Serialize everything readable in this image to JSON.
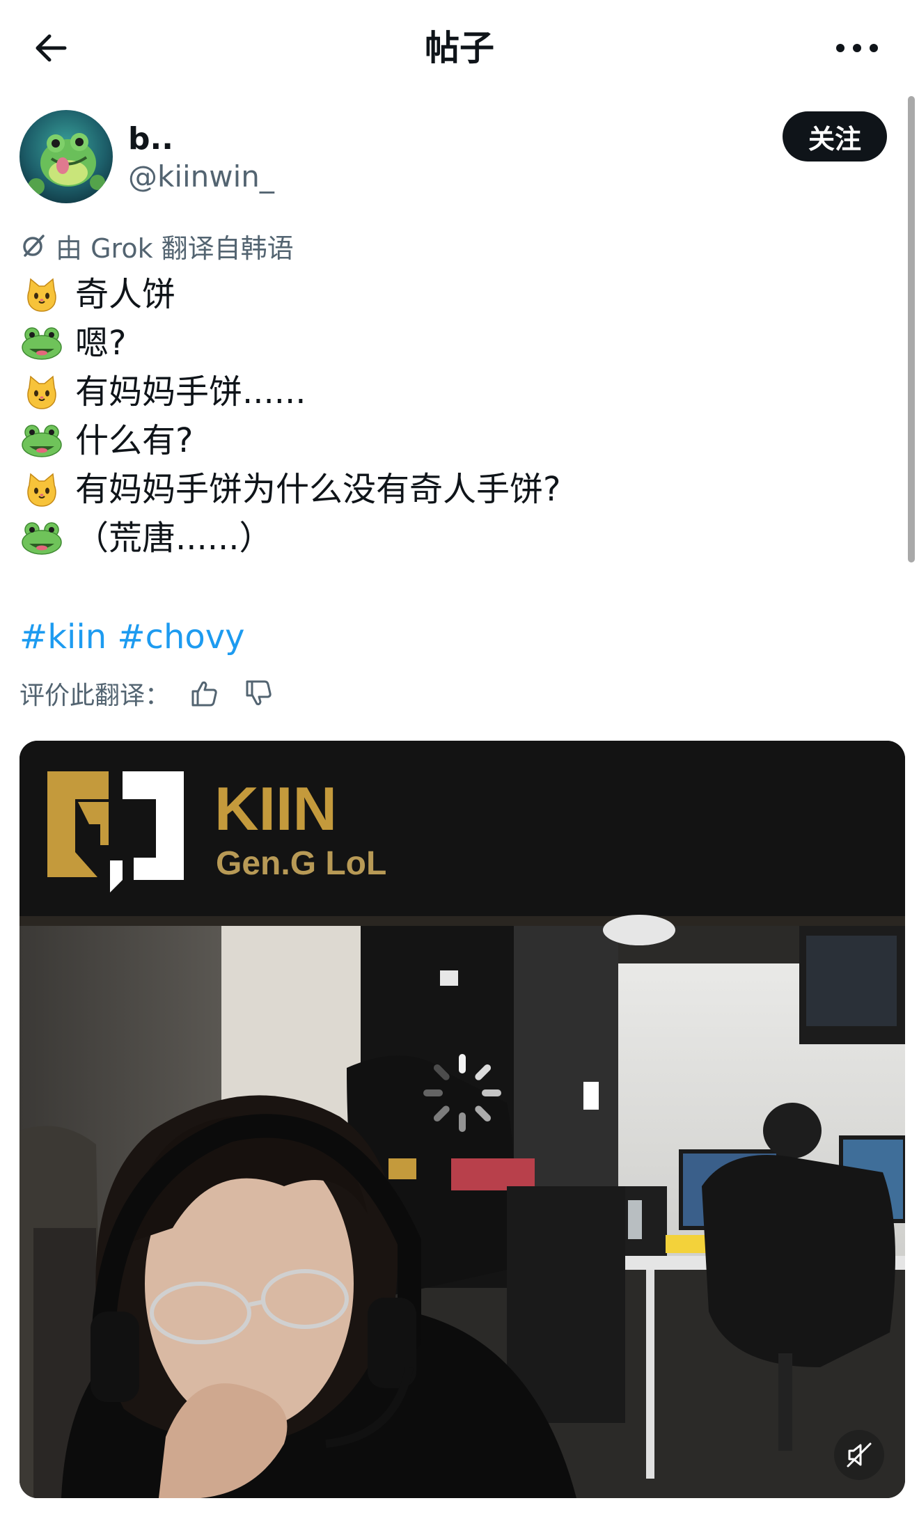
{
  "header": {
    "title": "帖子",
    "back_icon": "arrow-left-icon",
    "more_icon": "more-horizontal-icon"
  },
  "author": {
    "name": "b..",
    "handle": "@kiinwin_",
    "follow_label": "关注"
  },
  "translation": {
    "note": "由 Grok 翻译自韩语",
    "icon": "grok-icon"
  },
  "post": {
    "lines": [
      {
        "emoji": "cat-face-icon",
        "text": "奇人饼"
      },
      {
        "emoji": "frog-face-icon",
        "text": "嗯?"
      },
      {
        "emoji": "cat-face-icon",
        "text": "有妈妈手饼......"
      },
      {
        "emoji": "frog-face-icon",
        "text": "什么有?"
      },
      {
        "emoji": "cat-face-icon",
        "text": "有妈妈手饼为什么没有奇人手饼?"
      },
      {
        "emoji": "frog-face-icon",
        "text": "（荒唐......）"
      }
    ],
    "hashtags": [
      "#kiin",
      "#chovy"
    ]
  },
  "rating": {
    "label": "评价此翻译："
  },
  "media": {
    "banner_title": "KIIN",
    "banner_subtitle": "Gen.G LoL",
    "loading_icon": "loading-spinner-icon",
    "mute_icon": "muted-speaker-icon"
  },
  "colors": {
    "link": "#1d9bf0",
    "secondary": "#536471",
    "primary_text": "#0f1419",
    "gold": "#c49a3c"
  }
}
